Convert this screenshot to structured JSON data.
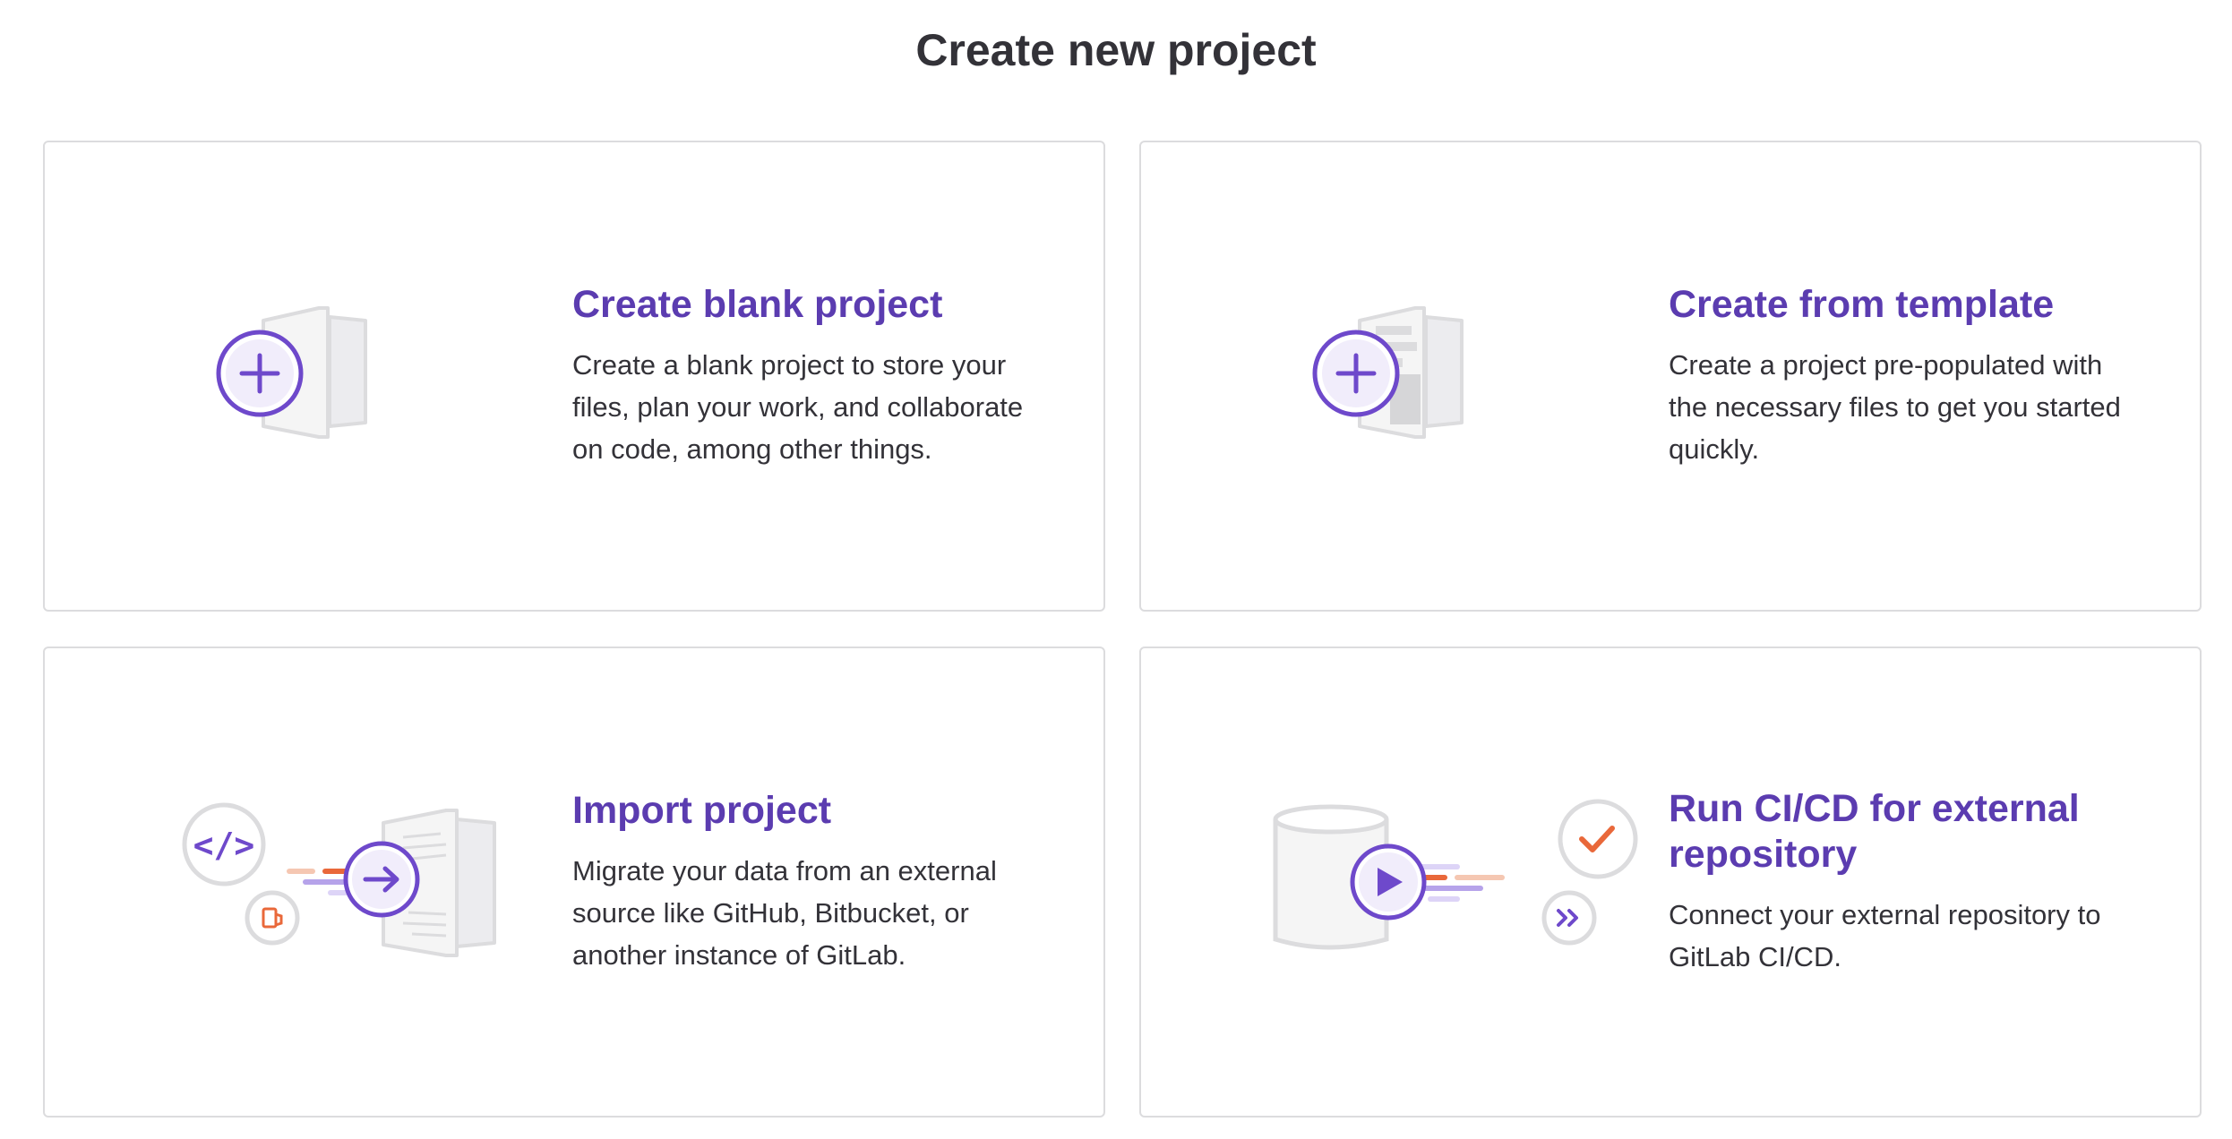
{
  "header": {
    "title": "Create new project"
  },
  "cards": [
    {
      "title": "Create blank project",
      "description": "Create a blank project to store your files, plan your work, and collaborate on code, among other things.",
      "icon": "blank-project-illustration"
    },
    {
      "title": "Create from template",
      "description": "Create a project pre-populated with the necessary files to get you started quickly.",
      "icon": "template-project-illustration"
    },
    {
      "title": "Import project",
      "description": "Migrate your data from an external source like GitHub, Bitbucket, or another instance of GitLab.",
      "icon": "import-project-illustration"
    },
    {
      "title": "Run CI/CD for external repository",
      "description": "Connect your external repository to GitLab CI/CD.",
      "icon": "cicd-project-illustration"
    }
  ],
  "colors": {
    "accent": "#5b3cb0",
    "illustration_purple": "#6e49cb",
    "illustration_orange": "#e9683a",
    "illustration_gray": "#dcdcde",
    "border": "#dcdcde"
  }
}
